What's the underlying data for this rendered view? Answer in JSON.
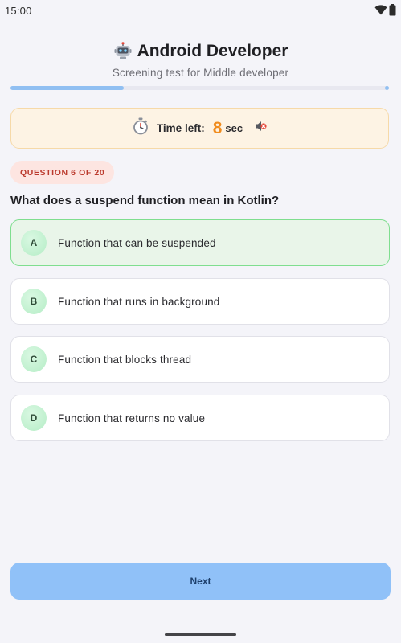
{
  "status_bar": {
    "time": "15:00",
    "icons": [
      "wifi-icon",
      "battery-icon"
    ]
  },
  "header": {
    "icon": "robot-icon",
    "title": "Android Developer",
    "subtitle": "Screening test for Middle developer"
  },
  "progress": {
    "fraction": 0.3
  },
  "timer": {
    "icon": "stopwatch-icon",
    "label": "Time left:",
    "value": "8",
    "unit": "sec",
    "sound_icon": "sound-muted-icon"
  },
  "question": {
    "badge": "QUESTION 6 OF 20",
    "text": "What does a suspend function mean in Kotlin?"
  },
  "options": [
    {
      "letter": "A",
      "text": "Function that can be suspended",
      "selected": true
    },
    {
      "letter": "B",
      "text": "Function that runs in background",
      "selected": false
    },
    {
      "letter": "C",
      "text": "Function that blocks thread",
      "selected": false
    },
    {
      "letter": "D",
      "text": "Function that returns no value",
      "selected": false
    }
  ],
  "next_button": {
    "label": "Next"
  },
  "colors": {
    "background": "#f4f4f9",
    "progress": "#90bff2",
    "timer_bg": "#fdf3e4",
    "timer_value": "#f08c1e",
    "badge_bg": "#fde5e1",
    "badge_text": "#bb3a2d",
    "selected_bg": "#e9f5e9",
    "selected_border": "#7fde8f",
    "next_button": "#90c1f8"
  }
}
